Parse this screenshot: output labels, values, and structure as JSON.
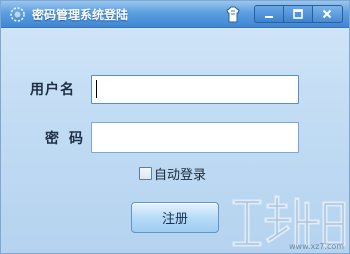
{
  "window": {
    "title": "密码管理系统登陆",
    "icon": "spinner-icon",
    "buttons": [
      "skin-icon",
      "minimize-icon",
      "maximize-icon",
      "close-icon"
    ]
  },
  "form": {
    "username_label": "用户名",
    "username_value": "",
    "password_label": "密码",
    "password_value": "",
    "auto_login_label": "自动登录",
    "auto_login_checked": false,
    "register_label": "注册"
  },
  "watermark": {
    "url": "www.xz7.com"
  },
  "colors": {
    "titlebar": "#4a90dc",
    "body": "#c2dcf4",
    "accent_button": "#b7dcf7"
  }
}
